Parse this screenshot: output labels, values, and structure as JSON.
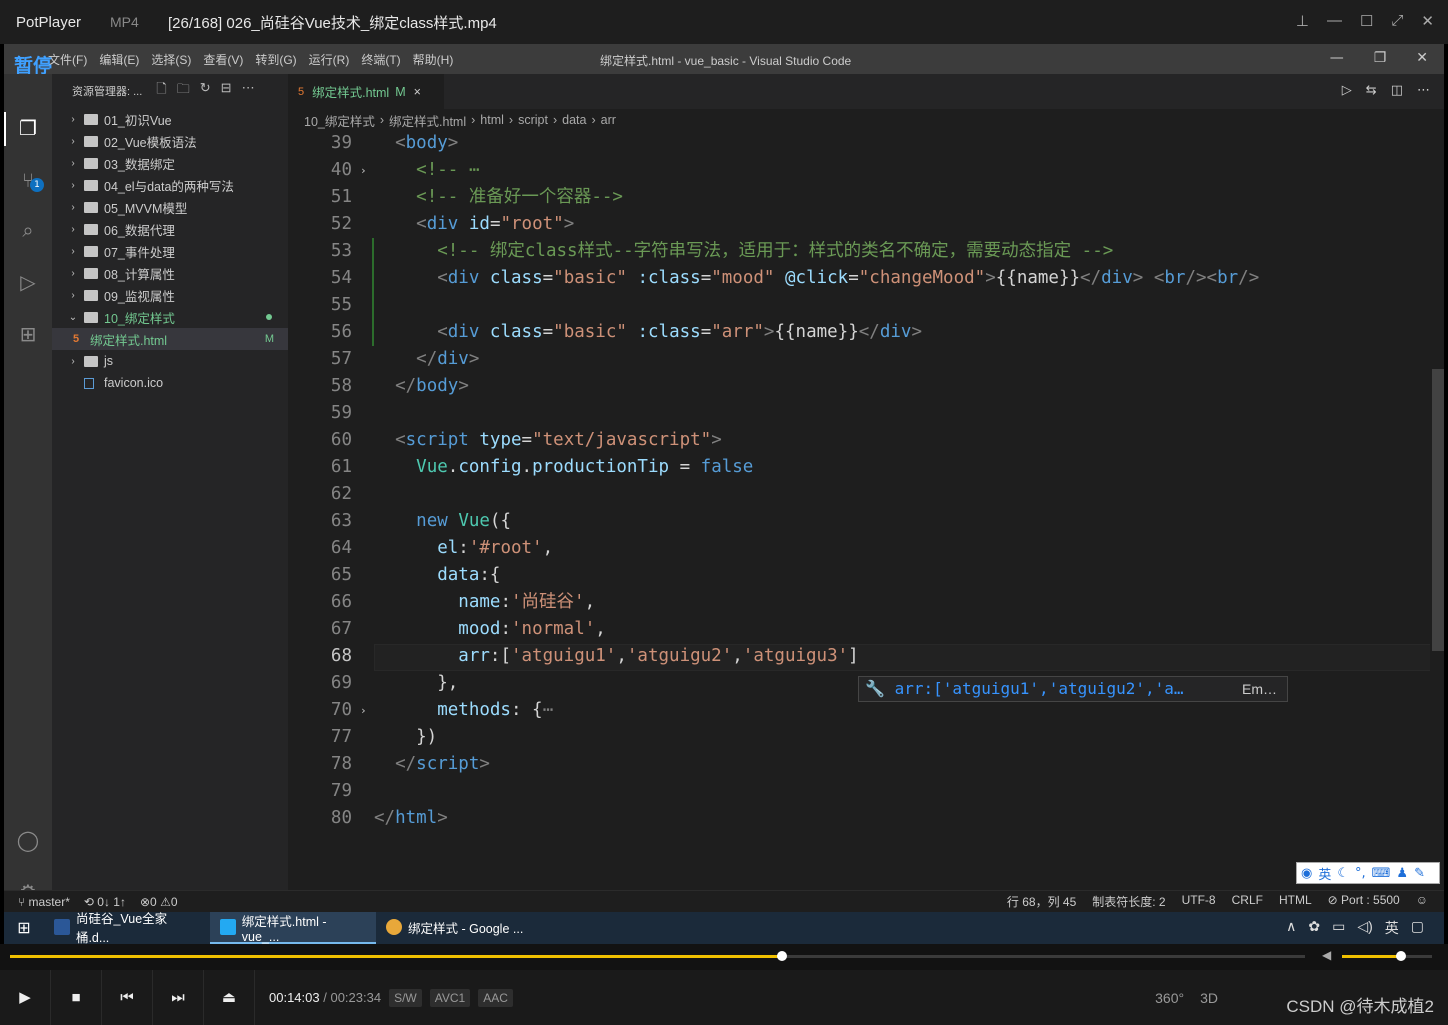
{
  "potplayer": {
    "brand": "PotPlayer",
    "format": "MP4",
    "file_title": "[26/168] 026_尚硅谷Vue技术_绑定class样式.mp4",
    "pause_overlay": "暂停"
  },
  "vscode": {
    "menu": [
      "文件(F)",
      "编辑(E)",
      "选择(S)",
      "查看(V)",
      "转到(G)",
      "运行(R)",
      "终端(T)",
      "帮助(H)"
    ],
    "window_title": "绑定样式.html - vue_basic - Visual Studio Code",
    "explorer_title": "资源管理器: ...",
    "scm_badge": "1",
    "tree": [
      {
        "label": "01_初识Vue",
        "type": "folder"
      },
      {
        "label": "02_Vue模板语法",
        "type": "folder"
      },
      {
        "label": "03_数据绑定",
        "type": "folder"
      },
      {
        "label": "04_el与data的两种写法",
        "type": "folder"
      },
      {
        "label": "05_MVVM模型",
        "type": "folder"
      },
      {
        "label": "06_数据代理",
        "type": "folder"
      },
      {
        "label": "07_事件处理",
        "type": "folder"
      },
      {
        "label": "08_计算属性",
        "type": "folder"
      },
      {
        "label": "09_监视属性",
        "type": "folder"
      },
      {
        "label": "10_绑定样式",
        "type": "folder-open"
      },
      {
        "label": "绑定样式.html",
        "type": "file",
        "mark": "M"
      },
      {
        "label": "js",
        "type": "folder"
      },
      {
        "label": "favicon.ico",
        "type": "file-plain"
      }
    ],
    "tab": {
      "label": "绑定样式.html",
      "mark": "M",
      "close": "×"
    },
    "breadcrumbs": [
      "10_绑定样式",
      "绑定样式.html",
      "html",
      "script",
      "data",
      "arr"
    ],
    "line_numbers": [
      "39",
      "40",
      "51",
      "52",
      "53",
      "54",
      "55",
      "56",
      "57",
      "58",
      "59",
      "60",
      "61",
      "62",
      "63",
      "64",
      "65",
      "66",
      "67",
      "68",
      "69",
      "70",
      "77",
      "78",
      "79",
      "80"
    ],
    "current_line": "68",
    "suggestion": {
      "text": "arr:['atguigu1','atguigu2','a…",
      "detail": "Em…"
    },
    "ime": "英",
    "status": {
      "branch": "master*",
      "sync": "0↓ 1↑",
      "problems": "0",
      "warnings": "0",
      "position": "行 68，列 45",
      "tab_size": "制表符长度: 2",
      "encoding": "UTF-8",
      "eol": "CRLF",
      "language": "HTML",
      "port": "Port : 5500"
    }
  },
  "taskbar": {
    "tasks": [
      "尚硅谷_Vue全家桶.d...",
      "绑定样式.html - vue_...",
      "绑定样式 - Google ..."
    ],
    "ime": "英"
  },
  "player": {
    "current_time": "00:14:03",
    "total_time": "00:23:34",
    "codecs": [
      "S/W",
      "AVC1",
      "AAC"
    ],
    "progress": 0.596,
    "volume": 0.65,
    "right_labels": [
      "360°",
      "3D"
    ],
    "watermark": "CSDN @待木成植2"
  }
}
